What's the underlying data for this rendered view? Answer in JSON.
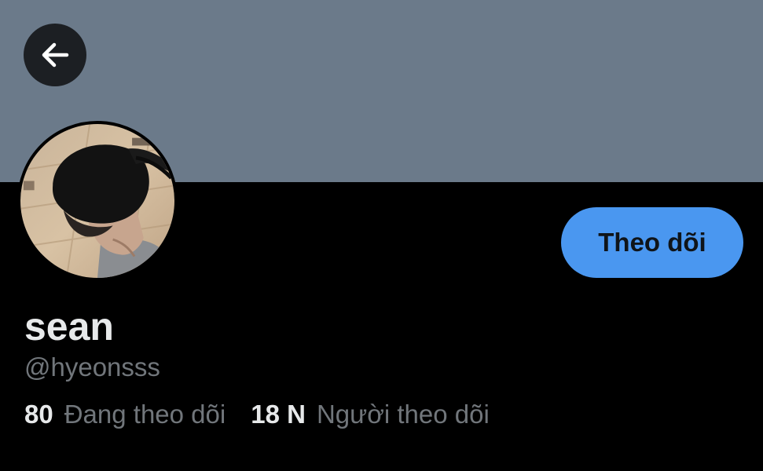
{
  "colors": {
    "banner": "#6b7a8a",
    "page_background": "#000000",
    "accent": "#4a97f0",
    "primary_text": "#e7e9ea",
    "secondary_text": "#71767b"
  },
  "header": {
    "back_icon": "arrow-left-icon"
  },
  "profile": {
    "display_name": "sean",
    "handle": "@hyeonsss",
    "follow_button_label": "Theo dõi",
    "stats": [
      {
        "count": "80",
        "label": "Đang theo dõi"
      },
      {
        "count": "18 N",
        "label": "Người theo dõi"
      }
    ]
  }
}
